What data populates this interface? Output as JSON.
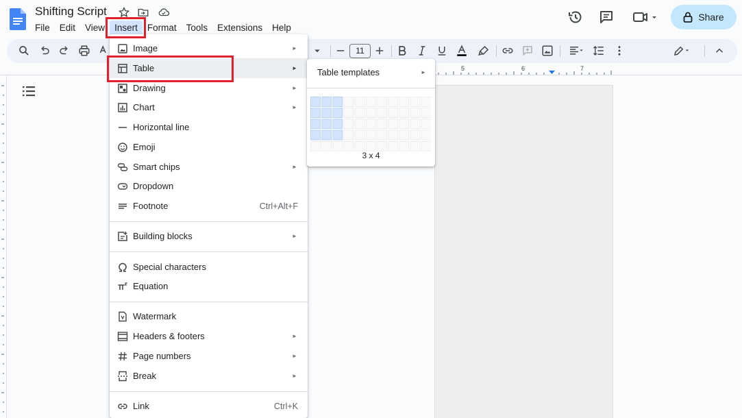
{
  "document": {
    "title": "Shifting Script"
  },
  "menubar": {
    "items": [
      "File",
      "Edit",
      "View",
      "Insert",
      "Format",
      "Tools",
      "Extensions",
      "Help"
    ],
    "active": "Insert"
  },
  "header": {
    "share_label": "Share"
  },
  "toolbar": {
    "font_size": "11"
  },
  "ruler": {
    "marks": [
      "5",
      "6",
      "7"
    ]
  },
  "insert_menu": {
    "items": [
      {
        "label": "Image",
        "icon": "image-icon",
        "submenu": true
      },
      {
        "label": "Table",
        "icon": "table-icon",
        "submenu": true
      },
      {
        "label": "Drawing",
        "icon": "drawing-icon",
        "submenu": true
      },
      {
        "label": "Chart",
        "icon": "chart-icon",
        "submenu": true
      },
      {
        "label": "Horizontal line",
        "icon": "horizontal-line-icon",
        "submenu": false
      },
      {
        "label": "Emoji",
        "icon": "emoji-icon",
        "submenu": false
      },
      {
        "label": "Smart chips",
        "icon": "smart-chips-icon",
        "submenu": true
      },
      {
        "label": "Dropdown",
        "icon": "dropdown-icon",
        "submenu": false
      },
      {
        "label": "Footnote",
        "icon": "footnote-icon",
        "shortcut": "Ctrl+Alt+F",
        "submenu": false
      },
      {
        "label": "Building blocks",
        "icon": "building-blocks-icon",
        "submenu": true
      },
      {
        "label": "Special characters",
        "icon": "omega-icon",
        "submenu": false
      },
      {
        "label": "Equation",
        "icon": "pi-icon",
        "submenu": false
      },
      {
        "label": "Watermark",
        "icon": "watermark-icon",
        "submenu": false
      },
      {
        "label": "Headers & footers",
        "icon": "headers-footers-icon",
        "submenu": true
      },
      {
        "label": "Page numbers",
        "icon": "hash-icon",
        "submenu": true
      },
      {
        "label": "Break",
        "icon": "break-icon",
        "submenu": true
      },
      {
        "label": "Link",
        "icon": "link-icon",
        "shortcut": "Ctrl+K",
        "submenu": false
      }
    ],
    "highlighted": "Table"
  },
  "table_submenu": {
    "templates_label": "Table templates",
    "grid": {
      "columns": 11,
      "rows": 5,
      "selected_columns": 3,
      "selected_rows": 4
    },
    "size_label": "3 x 4"
  },
  "colors": {
    "accent": "#c2e7ff",
    "highlight_box": "#e0202c",
    "grid_selected": "#d3e3fd"
  }
}
